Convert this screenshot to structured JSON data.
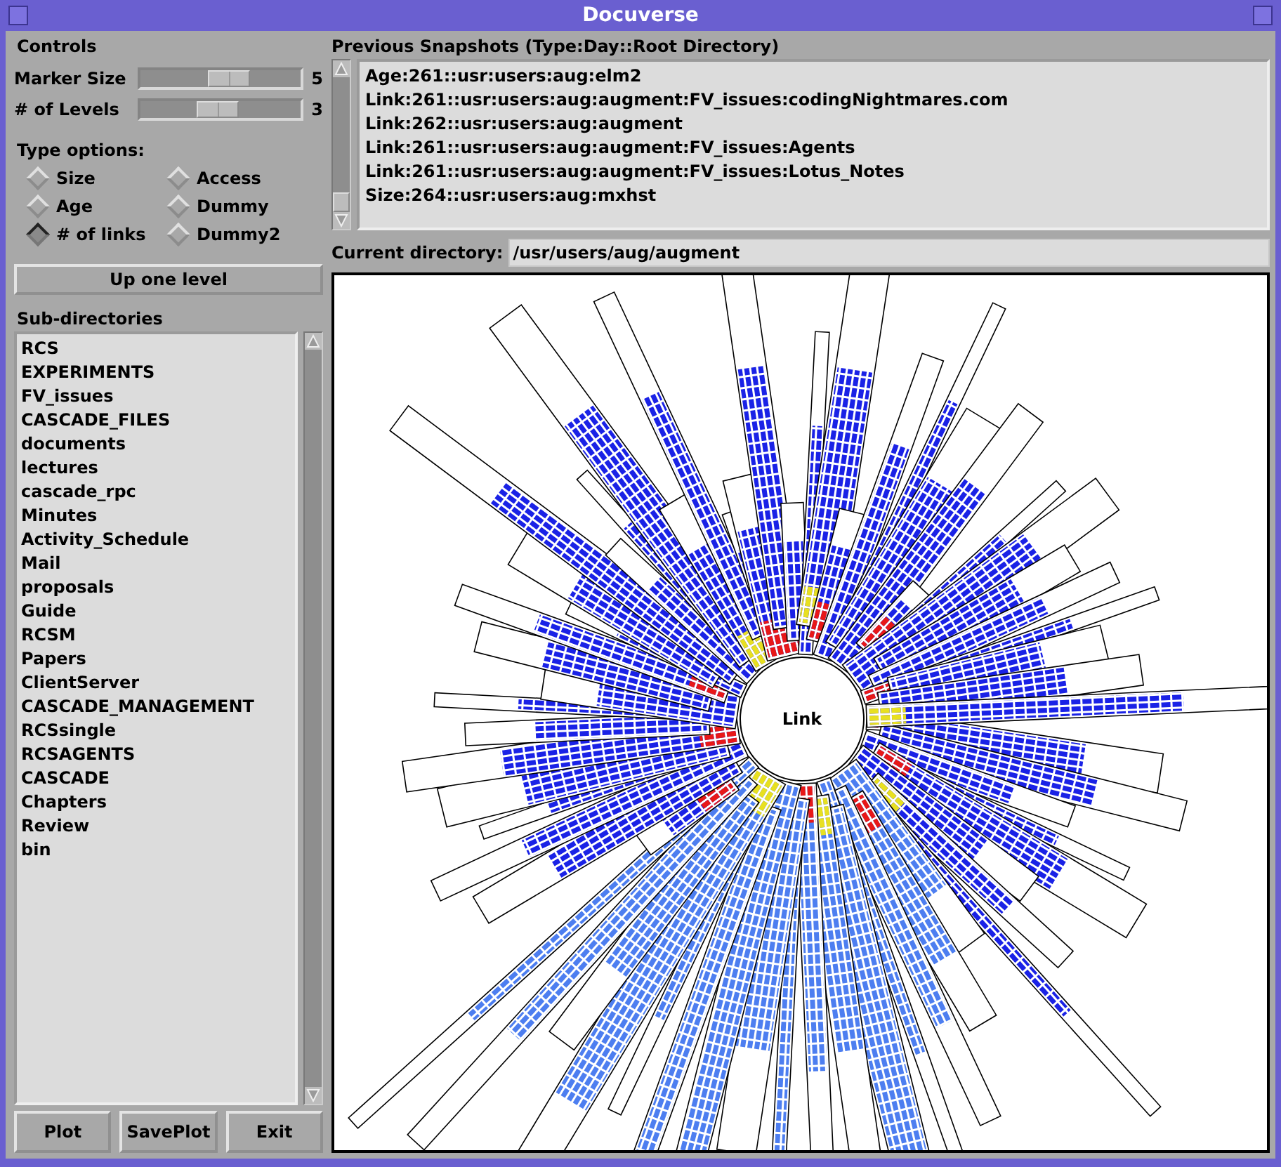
{
  "window": {
    "title": "Docuverse"
  },
  "controls": {
    "title": "Controls",
    "sliders": [
      {
        "label": "Marker Size",
        "level": 0.55,
        "reading": "5"
      },
      {
        "label": "# of Levels",
        "level": 0.48,
        "reading": "3"
      }
    ],
    "type_options": {
      "title": "Type options:",
      "options": [
        {
          "label": "Size",
          "selected": false
        },
        {
          "label": "Access",
          "selected": false
        },
        {
          "label": "Age",
          "selected": false
        },
        {
          "label": "Dummy",
          "selected": false
        },
        {
          "label": "# of links",
          "selected": true
        },
        {
          "label": "Dummy2",
          "selected": false
        }
      ]
    },
    "up_button": "Up one level"
  },
  "subdirectories": {
    "title": "Sub-directories",
    "items": [
      "RCS",
      "EXPERIMENTS",
      "FV_issues",
      "CASCADE_FILES",
      "documents",
      "lectures",
      "cascade_rpc",
      "Minutes",
      "Activity_Schedule",
      "Mail",
      "proposals",
      "Guide",
      "RCSM",
      "Papers",
      "ClientServer",
      "CASCADE_MANAGEMENT",
      "RCSsingle",
      "RCSAGENTS",
      "CASCADE",
      "Chapters",
      "Review",
      "bin"
    ]
  },
  "buttons": [
    "Plot",
    "SavePlot",
    "Exit"
  ],
  "snapshots": {
    "title": "Previous Snapshots (Type:Day::Root Directory)",
    "items": [
      "Age:261::usr:users:aug:elm2",
      "Link:261::usr:users:aug:augment:FV_issues:codingNightmares.com",
      "Link:262::usr:users:aug:augment",
      "Link:261::usr:users:aug:augment:FV_issues:Agents",
      "Link:261::usr:users:aug:augment:FV_issues:Lotus_Notes",
      "Size:264::usr:users:aug:mxhst"
    ]
  },
  "current_directory": {
    "label": "Current directory:",
    "value": "/usr/users/aug/augment"
  },
  "plot": {
    "center_label": "Link"
  }
}
